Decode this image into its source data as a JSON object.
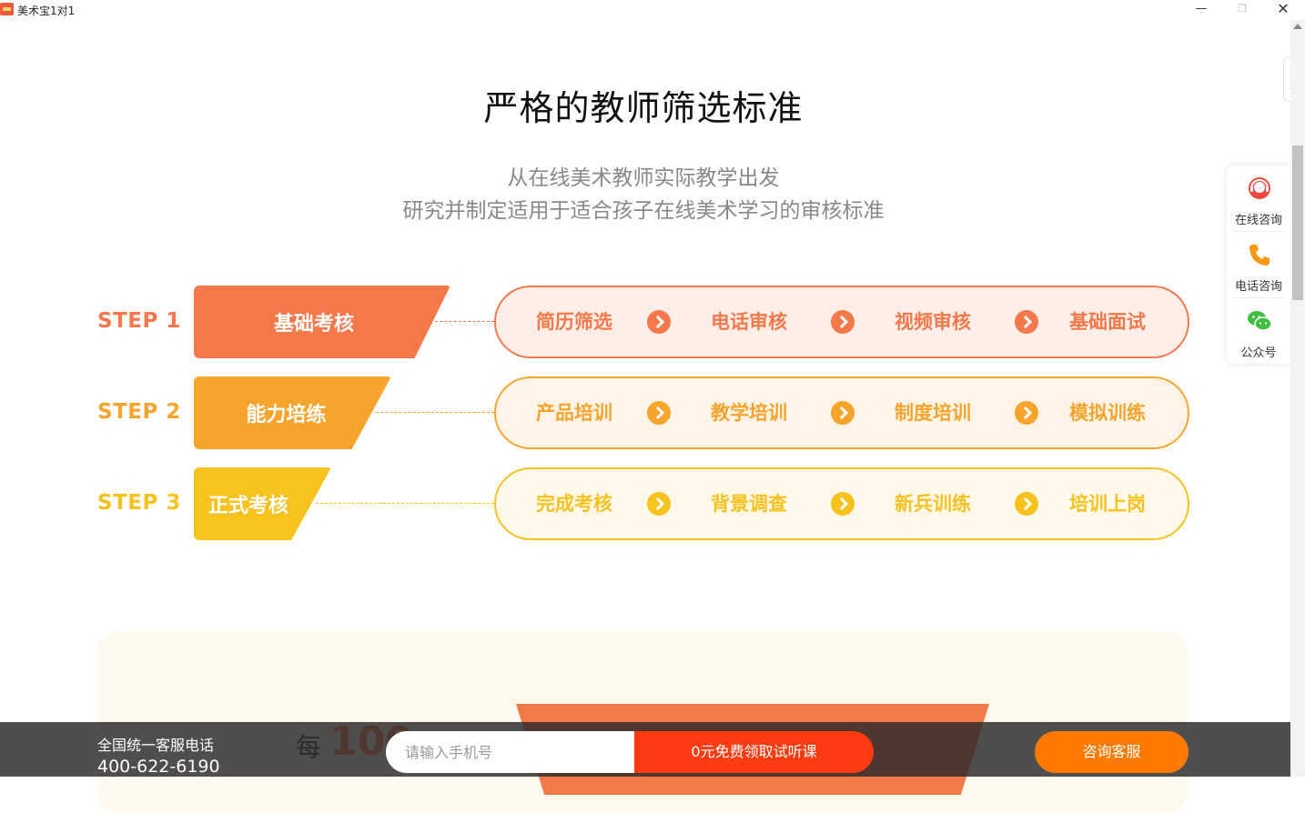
{
  "window": {
    "title": "美术宝1对1",
    "minimize": "—",
    "maximize": "❐",
    "close": "✕"
  },
  "heading": {
    "title": "严格的教师筛选标准",
    "subtitle_line1": "从在线美术教师实际教学出发",
    "subtitle_line2": "研究并制定适用于适合孩子在线美术学习的审核标准"
  },
  "steps": [
    {
      "label": "STEP 1",
      "tag": "基础考核",
      "color": "#f5784a",
      "pill_bg": "#fdeee8",
      "text_color": "#f5784a",
      "items": [
        "简历筛选",
        "电话审核",
        "视频审核",
        "基础面试"
      ]
    },
    {
      "label": "STEP 2",
      "tag": "能力培练",
      "color": "#f7a42c",
      "pill_bg": "#fdf3e7",
      "text_color": "#f7a42c",
      "items": [
        "产品培训",
        "教学培训",
        "制度培训",
        "模拟训练"
      ]
    },
    {
      "label": "STEP 3",
      "tag": "正式考核",
      "color": "#f8c21e",
      "pill_bg": "#fdf8ea",
      "text_color": "#f8c21e",
      "items": [
        "完成考核",
        "背景调查",
        "新兵训练",
        "培训上岗"
      ]
    }
  ],
  "service_panel": {
    "online": "在线咨询",
    "phone": "电话咨询",
    "wechat": "公众号"
  },
  "lower_section": {
    "prefix": "每",
    "number": "100"
  },
  "bottom_bar": {
    "hotline_label": "全国统一客服电话",
    "hotline_number": "400-622-6190",
    "phone_placeholder": "请输入手机号",
    "trial_button": "0元免费领取试听课",
    "consult_button": "咨询客服"
  }
}
